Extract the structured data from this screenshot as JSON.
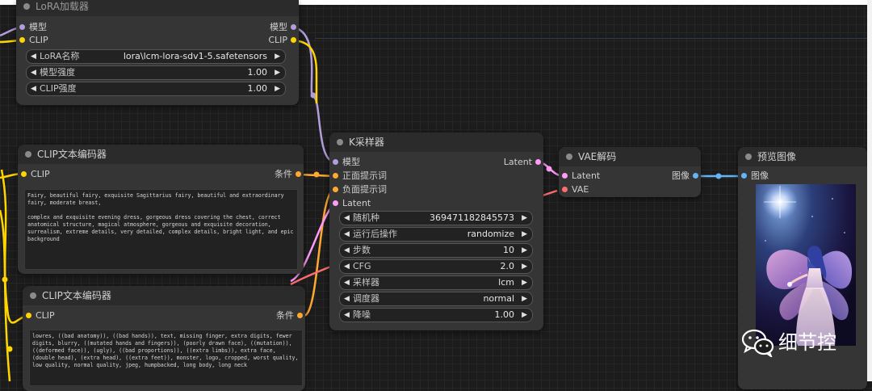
{
  "colors": {
    "model": "#b39ddb",
    "clip": "#ffd500",
    "conditioning": "#ffa931",
    "latent": "#ff9cf9",
    "vae": "#ff6e6e",
    "image": "#64b5f6",
    "int": "#9e9e9e"
  },
  "lora_node": {
    "title": "LoRA加载器",
    "in_model": "模型",
    "in_clip": "CLIP",
    "out_model": "模型",
    "out_clip": "CLIP",
    "widgets": [
      {
        "label": "LoRA名称",
        "value": "lora\\lcm-lora-sdv1-5.safetensors"
      },
      {
        "label": "模型强度",
        "value": "1.00"
      },
      {
        "label": "CLIP强度",
        "value": "1.00"
      }
    ]
  },
  "clip_pos_node": {
    "title": "CLIP文本编码器",
    "in_clip": "CLIP",
    "out": "条件",
    "text": "Fairy, beautiful fairy, exquisite Sagittarius fairy, beautiful and extraordinary fairy, moderate breast,\n\ncomplex and exquisite evening dress, gorgeous dress covering the chest, correct anatomical structure, magical atmosphere, gorgeous and exquisite decoration, surrealism, extreme details, very detailed, complex details, bright light, and epic background"
  },
  "clip_neg_node": {
    "title": "CLIP文本编码器",
    "in_clip": "CLIP",
    "out": "条件",
    "text": "lowres, ((bad anatomy)), ((bad hands)), text, missing finger, extra digits, fewer digits, blurry, ((mutated hands and fingers)), (poorly drawn face), ((mutation)), ((deformed face)), (ugly), ((bad proportions)), ((extra limbs)), extra face, (double head), (extra head), ((extra feet)), monster, logo, cropped, worst quality, low quality, normal quality, jpeg, humpbacked, long body, long neck"
  },
  "ksampler_node": {
    "title": "K采样器",
    "in_model": "模型",
    "in_positive": "正面提示词",
    "in_negative": "负面提示词",
    "in_latent": "Latent",
    "out_latent": "Latent",
    "widgets": [
      {
        "label": "随机种",
        "value": "369471182845573"
      },
      {
        "label": "运行后操作",
        "value": "randomize"
      },
      {
        "label": "步数",
        "value": "10"
      },
      {
        "label": "CFG",
        "value": "2.0"
      },
      {
        "label": "采样器",
        "value": "lcm"
      },
      {
        "label": "调度器",
        "value": "normal"
      },
      {
        "label": "降噪",
        "value": "1.00"
      }
    ]
  },
  "vae_node": {
    "title": "VAE解码",
    "in_latent": "Latent",
    "in_vae": "VAE",
    "out_image": "图像"
  },
  "preview_node": {
    "title": "预览图像",
    "in_image": "图像"
  },
  "watermark": {
    "text": "细节控",
    "icon": "wechat-icon"
  }
}
